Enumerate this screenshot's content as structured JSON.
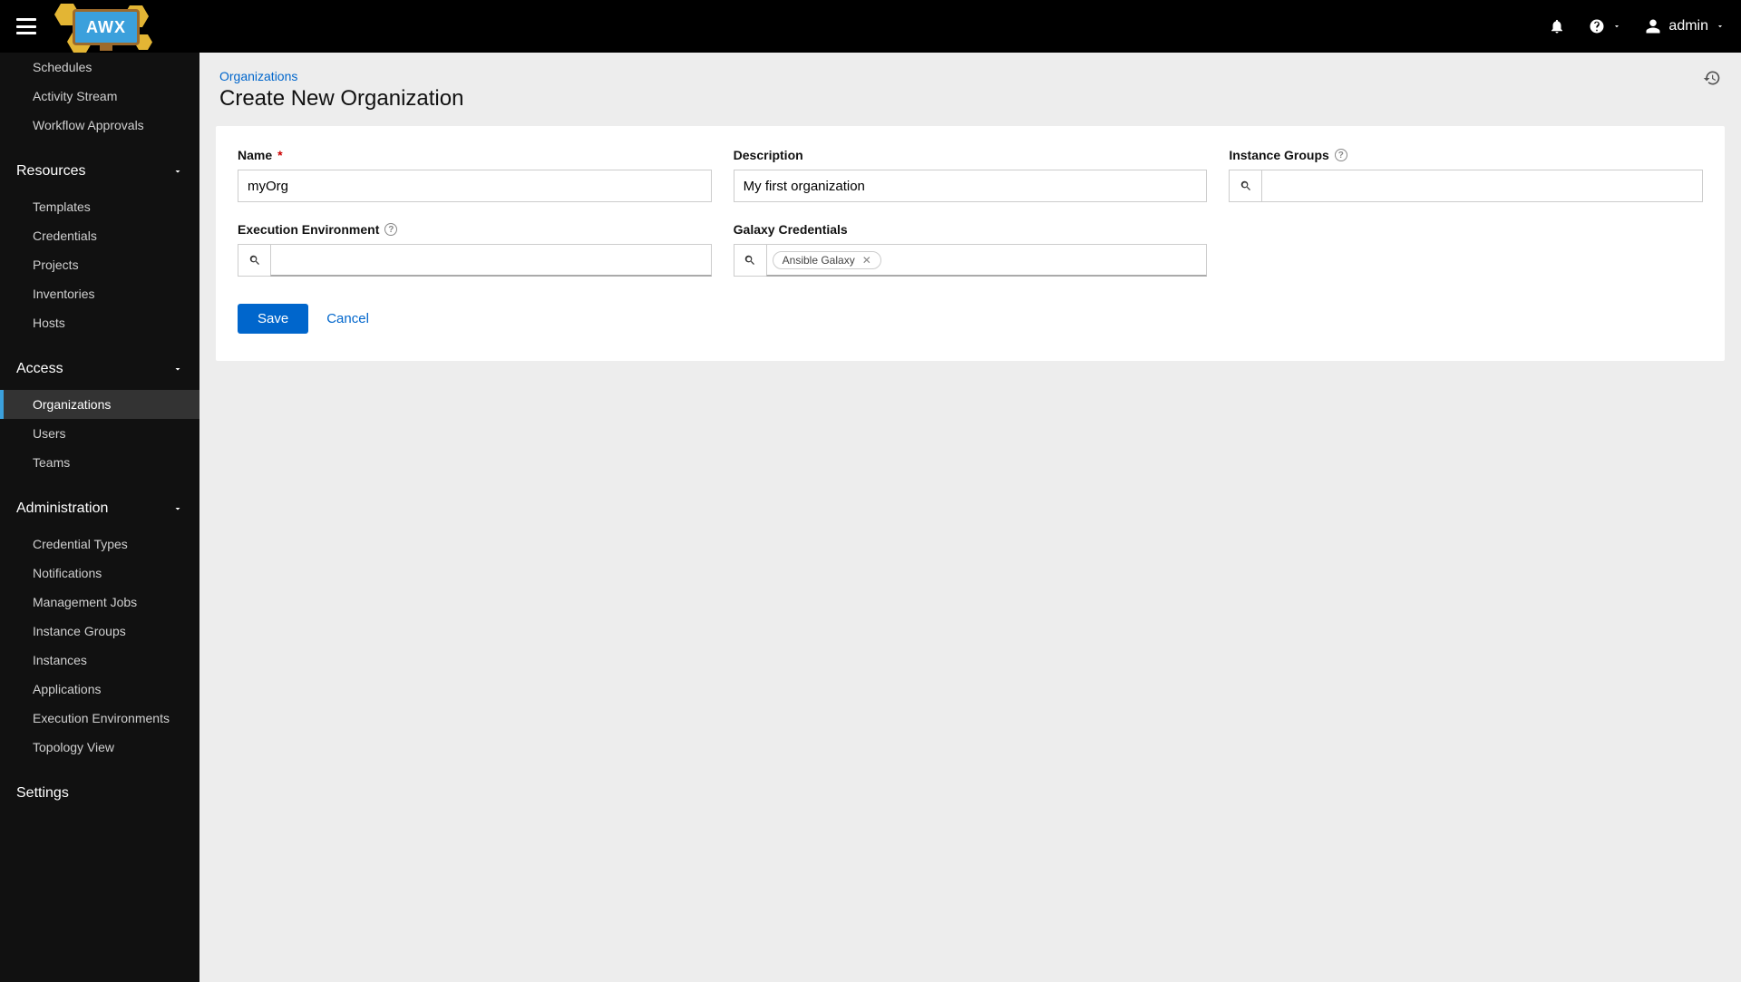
{
  "header": {
    "logo_text": "AWX",
    "username": "admin"
  },
  "sidebar": {
    "views_items": [
      "Schedules",
      "Activity Stream",
      "Workflow Approvals"
    ],
    "resources_label": "Resources",
    "resources_items": [
      "Templates",
      "Credentials",
      "Projects",
      "Inventories",
      "Hosts"
    ],
    "access_label": "Access",
    "access_items": [
      "Organizations",
      "Users",
      "Teams"
    ],
    "admin_label": "Administration",
    "admin_items": [
      "Credential Types",
      "Notifications",
      "Management Jobs",
      "Instance Groups",
      "Instances",
      "Applications",
      "Execution Environments",
      "Topology View"
    ],
    "settings_label": "Settings"
  },
  "page": {
    "breadcrumb": "Organizations",
    "title": "Create New Organization"
  },
  "form": {
    "name_label": "Name",
    "name_value": "myOrg",
    "description_label": "Description",
    "description_value": "My first organization",
    "instance_groups_label": "Instance Groups",
    "exec_env_label": "Execution Environment",
    "galaxy_label": "Galaxy Credentials",
    "galaxy_chip": "Ansible Galaxy",
    "save_label": "Save",
    "cancel_label": "Cancel"
  }
}
